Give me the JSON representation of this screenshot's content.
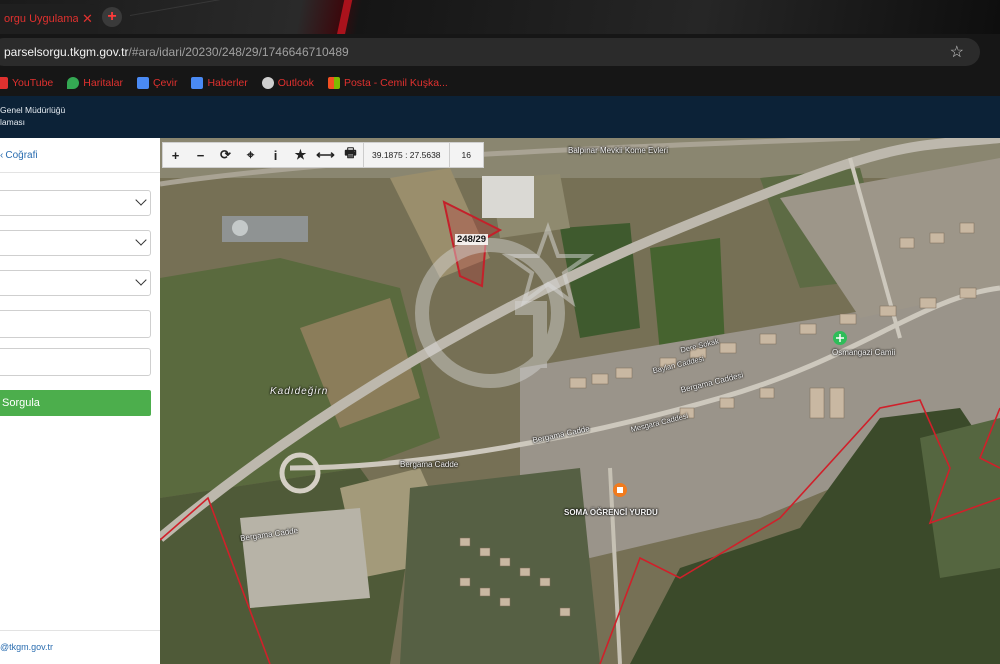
{
  "browser": {
    "tab_title": "orgu Uygulamas",
    "tab_close": "✕",
    "new_tab": "+",
    "url_host": "parselsorgu.tkgm.gov.tr",
    "url_path": "/#ara/idari/20230/248/29/1746646710489",
    "bookmark_star": "☆",
    "bookmarks": [
      {
        "label": "YouTube",
        "color": "#e0312f"
      },
      {
        "label": "Haritalar",
        "color": "#34a853"
      },
      {
        "label": "Çevir",
        "color": "#4a8af4"
      },
      {
        "label": "Haberler",
        "color": "#4a8af4"
      },
      {
        "label": "Outlook",
        "color": "#cfcfcf"
      },
      {
        "label": "Posta - Cemil Kuşka...",
        "color": "#f2b600"
      }
    ]
  },
  "header": {
    "org_line1": "Genel Müdürlüğü",
    "org_line2": "laması"
  },
  "sidebar": {
    "tab_label": "Coğrafi",
    "tab_chevron": "‹",
    "query_button": "Sorgula",
    "footer_email": "@tkgm.gov.tr"
  },
  "toolbar": {
    "zoom_in": "+",
    "zoom_out": "−",
    "refresh": "⟳",
    "locate": "⌖",
    "info": "i",
    "favorite": "★",
    "measure": "⟷",
    "print": "🖶",
    "coordinates": "39.1875 : 27.5638",
    "zoom_level": "16"
  },
  "map": {
    "parcel_label": "248/29",
    "place_kadidegirn": "Kadıdeğirn",
    "street_bergama_top": "Bergama Caddesi",
    "street_bergama_mid": "Bergama Cadde",
    "street_bergama_low": "Bergama Cadde",
    "street_bergama_sw": "Bergama Cadde",
    "mosque": "Osmangazi Camii",
    "dorm": "SOMA ÖĞRENCİ YURDU",
    "top_label": "Balpınar Mevkii Kome Evleri",
    "street_dere": "Dere Sokak",
    "street_baylan": "Baylan Caddesi",
    "street_mesgara": "Mesgara Caddesi",
    "colors": {
      "parcel": "#c4202a",
      "boundary": "#d0202a",
      "accent_green": "#4cae4c",
      "header": "#0c2237"
    }
  }
}
